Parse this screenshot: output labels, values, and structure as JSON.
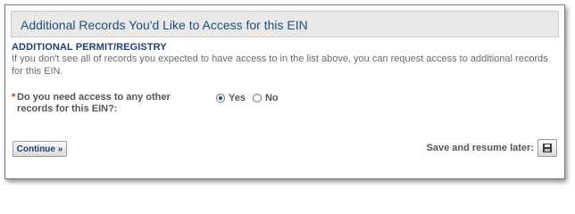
{
  "header": {
    "title": "Additional Records You'd Like to Access for this EIN"
  },
  "section": {
    "title": "ADDITIONAL PERMIT/REGISTRY",
    "description": "If you don't see all of records you expected to have access to in the list above, you can request access to additional records for this EIN."
  },
  "question": {
    "required_marker": "*",
    "label": "Do you need access to any other records for this EIN?:",
    "options": [
      {
        "label": "Yes",
        "selected": true
      },
      {
        "label": "No",
        "selected": false
      }
    ]
  },
  "actions": {
    "continue_label": "Continue »",
    "save_label": "Save and resume later:",
    "save_icon": "save-icon"
  },
  "colors": {
    "header_text": "#1f4e79",
    "section_title": "#1f3f73",
    "required": "#c0392b"
  }
}
